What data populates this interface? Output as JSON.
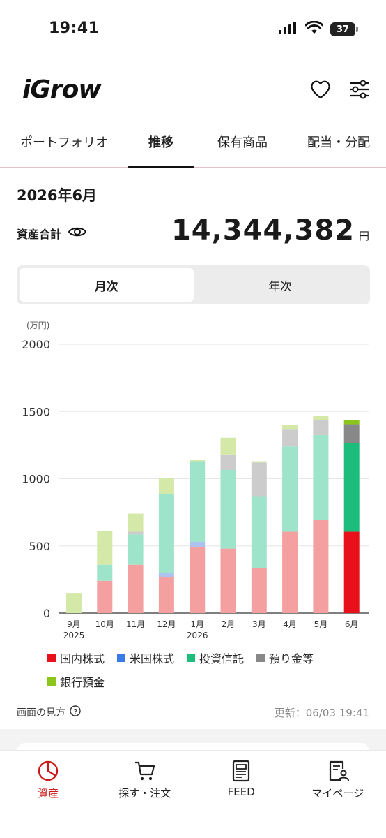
{
  "status_bar": {
    "time": "19:41",
    "battery": "37"
  },
  "header": {
    "logo": "iGrow",
    "icons": [
      "heart-icon",
      "settings-sliders-icon"
    ]
  },
  "tabs": [
    {
      "label": "ポートフォリオ",
      "active": false
    },
    {
      "label": "推移",
      "active": true
    },
    {
      "label": "保有商品",
      "active": false
    },
    {
      "label": "配当・分配",
      "active": false
    }
  ],
  "summary": {
    "date": "2026年6月",
    "total_label": "資産合計",
    "total_value": "14,344,382",
    "total_unit": "円"
  },
  "segmented": {
    "monthly": "月次",
    "yearly": "年次",
    "selected": "monthly"
  },
  "chart_data": {
    "type": "bar",
    "stacked": true,
    "unit_label": "(万円)",
    "ylim": [
      0,
      2000
    ],
    "yticks": [
      0,
      500,
      1000,
      1500,
      2000
    ],
    "categories": [
      {
        "month": "9月",
        "year": "2025"
      },
      {
        "month": "10月",
        "year": ""
      },
      {
        "month": "11月",
        "year": ""
      },
      {
        "month": "12月",
        "year": ""
      },
      {
        "month": "1月",
        "year": "2026"
      },
      {
        "month": "2月",
        "year": ""
      },
      {
        "month": "3月",
        "year": ""
      },
      {
        "month": "4月",
        "year": ""
      },
      {
        "month": "5月",
        "year": ""
      },
      {
        "month": "6月",
        "year": ""
      }
    ],
    "highlight_index": 9,
    "series": [
      {
        "name": "国内株式",
        "color": "#e8101b",
        "faded_color": "#f4a0a0",
        "values": [
          0,
          240,
          360,
          270,
          490,
          480,
          335,
          605,
          695,
          605
        ]
      },
      {
        "name": "米国株式",
        "color": "#3a7ae8",
        "faded_color": "#aec2f0",
        "values": [
          0,
          0,
          0,
          30,
          40,
          0,
          0,
          0,
          0,
          0
        ]
      },
      {
        "name": "投資信託",
        "color": "#1cbc7c",
        "faded_color": "#9ee4ca",
        "values": [
          0,
          120,
          225,
          585,
          600,
          585,
          535,
          635,
          630,
          660
        ]
      },
      {
        "name": "預り金等",
        "color": "#888888",
        "faded_color": "#cccccc",
        "values": [
          0,
          0,
          20,
          0,
          0,
          115,
          250,
          125,
          110,
          140
        ]
      },
      {
        "name": "銀行預金",
        "color": "#8cc51c",
        "faded_color": "#d4e8a8",
        "values": [
          150,
          250,
          135,
          120,
          10,
          125,
          10,
          35,
          30,
          30
        ]
      }
    ]
  },
  "help": {
    "label": "画面の見方"
  },
  "updated": "更新：06/03 19:41",
  "bottom_nav": [
    {
      "label": "資産",
      "icon": "asset-pie-icon",
      "active": true
    },
    {
      "label": "探す・注文",
      "icon": "cart-icon",
      "active": false
    },
    {
      "label": "FEED",
      "icon": "feed-document-icon",
      "active": false
    },
    {
      "label": "マイページ",
      "icon": "mypage-profile-icon",
      "active": false
    }
  ]
}
